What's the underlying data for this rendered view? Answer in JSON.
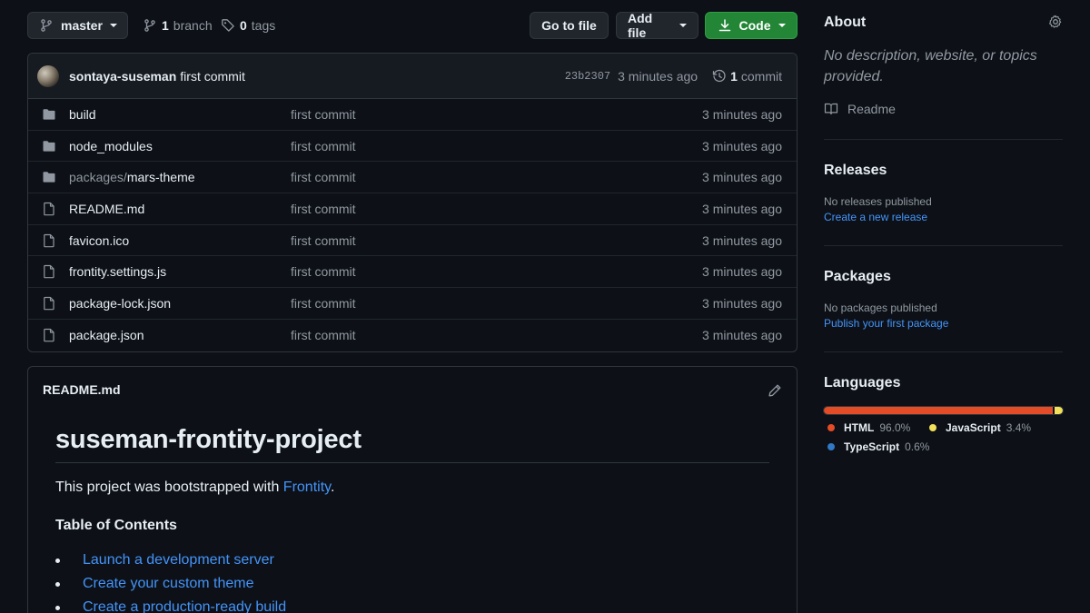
{
  "toolbar": {
    "branch_button": "master",
    "branch_count": "1",
    "branch_word": "branch",
    "tag_count": "0",
    "tag_word": "tags",
    "go_to_file": "Go to file",
    "add_file": "Add file",
    "code": "Code"
  },
  "commit": {
    "author": "sontaya-suseman",
    "message": "first commit",
    "sha": "23b2307",
    "time": "3 minutes ago",
    "commit_count": "1",
    "commit_word": "commit"
  },
  "files": [
    {
      "prefix": "",
      "name": "build",
      "type": "folder",
      "message": "first commit",
      "age": "3 minutes ago"
    },
    {
      "prefix": "",
      "name": "node_modules",
      "type": "folder",
      "message": "first commit",
      "age": "3 minutes ago"
    },
    {
      "prefix": "packages/",
      "name": "mars-theme",
      "type": "folder",
      "message": "first commit",
      "age": "3 minutes ago"
    },
    {
      "prefix": "",
      "name": "README.md",
      "type": "file",
      "message": "first commit",
      "age": "3 minutes ago"
    },
    {
      "prefix": "",
      "name": "favicon.ico",
      "type": "file",
      "message": "first commit",
      "age": "3 minutes ago"
    },
    {
      "prefix": "",
      "name": "frontity.settings.js",
      "type": "file",
      "message": "first commit",
      "age": "3 minutes ago"
    },
    {
      "prefix": "",
      "name": "package-lock.json",
      "type": "file",
      "message": "first commit",
      "age": "3 minutes ago"
    },
    {
      "prefix": "",
      "name": "package.json",
      "type": "file",
      "message": "first commit",
      "age": "3 minutes ago"
    }
  ],
  "readme": {
    "file_title": "README.md",
    "heading": "suseman-frontity-project",
    "intro_before": "This project was bootstrapped with ",
    "intro_link": "Frontity",
    "intro_after": ".",
    "toc_heading": "Table of Contents",
    "toc": [
      "Launch a development server",
      "Create your custom theme",
      "Create a production-ready build"
    ]
  },
  "sidebar": {
    "about_heading": "About",
    "about_desc": "No description, website, or topics provided.",
    "readme_label": "Readme",
    "releases_heading": "Releases",
    "releases_none": "No releases published",
    "releases_link": "Create a new release",
    "packages_heading": "Packages",
    "packages_none": "No packages published",
    "packages_link": "Publish your first package",
    "languages_heading": "Languages",
    "languages": [
      {
        "name": "HTML",
        "pct": "96.0%",
        "value": 96.0,
        "color": "#e34c26"
      },
      {
        "name": "JavaScript",
        "pct": "3.4%",
        "value": 3.4,
        "color": "#f1e05a"
      },
      {
        "name": "TypeScript",
        "pct": "0.6%",
        "value": 0.6,
        "color": "#3178c6"
      }
    ]
  },
  "colors": {
    "background": "#0d1117",
    "border": "#30363d",
    "link": "#4493f8",
    "green_button": "#238636"
  }
}
